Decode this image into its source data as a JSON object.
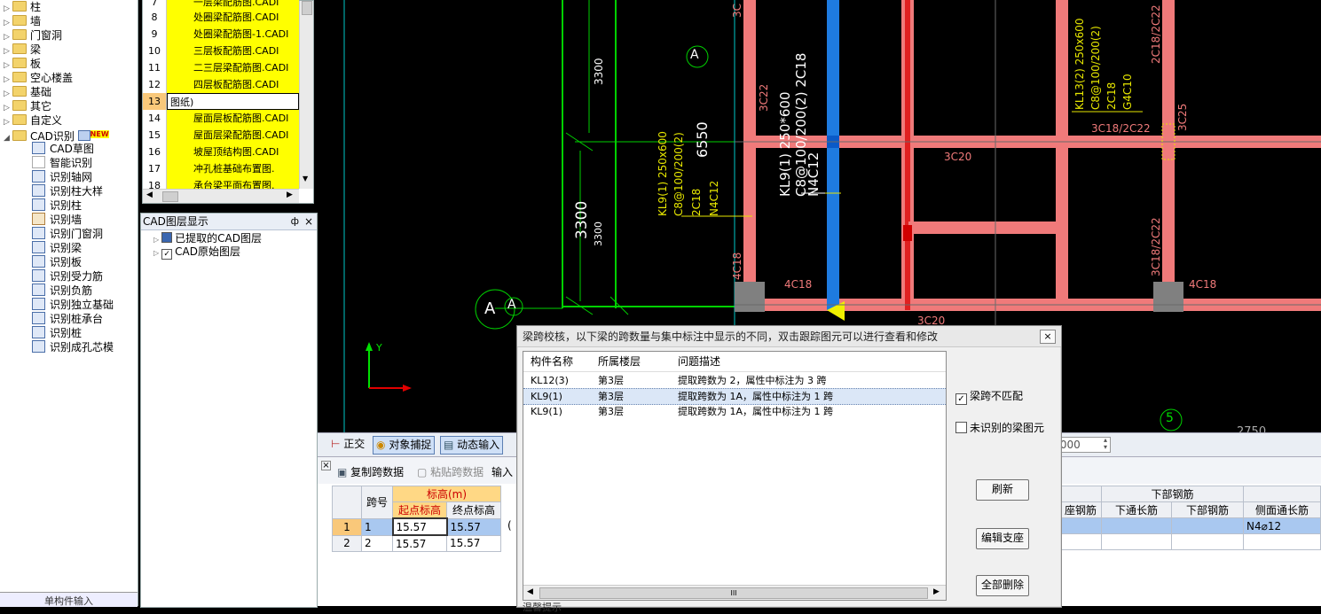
{
  "tree": {
    "nodes": [
      "柱",
      "墙",
      "门窗洞",
      "梁",
      "板",
      "空心楼盖",
      "基础",
      "其它",
      "自定义",
      "CAD识别"
    ],
    "new_badge": "NEW",
    "cad_children": [
      "CAD草图",
      "智能识别",
      "识别轴网",
      "识别柱大样",
      "识别柱",
      "识别墙",
      "识别门窗洞",
      "识别梁",
      "识别板",
      "识别受力筋",
      "识别负筋",
      "识别独立基础",
      "识别桩承台",
      "识别桩",
      "识别成孔芯模"
    ],
    "bottom_label": "单构件输入"
  },
  "drawings": {
    "rows": [
      {
        "num": "7",
        "name": "一层梁配筋图.CADI"
      },
      {
        "num": "8",
        "name": "处圈梁配筋图.CADI"
      },
      {
        "num": "9",
        "name": "处圈梁配筋图-1.CADI"
      },
      {
        "num": "10",
        "name": "三层板配筋图.CADI"
      },
      {
        "num": "11",
        "name": "二三层梁配筋图.CADI"
      },
      {
        "num": "12",
        "name": "四层板配筋图.CADI"
      },
      {
        "num": "13",
        "name": "图纸)"
      },
      {
        "num": "14",
        "name": "屋面层板配筋图.CADI"
      },
      {
        "num": "15",
        "name": "屋面层梁配筋图.CADI"
      },
      {
        "num": "16",
        "name": "坡屋顶结构图.CADI"
      },
      {
        "num": "17",
        "name": "冲孔桩基础布置图."
      },
      {
        "num": "18",
        "name": "承台梁平面布置图."
      }
    ]
  },
  "layers": {
    "title": "CAD图层显示",
    "pin": "ф",
    "close": "×",
    "items": [
      "已提取的CAD图层",
      "CAD原始图层"
    ]
  },
  "cad": {
    "axis_label": "A",
    "axis_5": "5",
    "y_label": "Y",
    "dim_3300": "3300",
    "dim_6550": "6550",
    "kl9_label": "KL9(1) 250*600",
    "kl9_stirrup": "C8@100/200(2) 2C18",
    "kl9_bottom": "N4C12",
    "kl9_left_1": "KL9(1) 250x600",
    "kl9_left_2": "C8@100/200(2)",
    "kl9_left_3": "2C18",
    "kl9_left_4": "N4C12",
    "kl13_1": "KL13(2) 250x600",
    "kl13_2": "C8@100/200(2)",
    "kl13_3": "2C18",
    "kl13_4": "G4C10",
    "r_3c22": "3C22",
    "r_3c20": "3C20",
    "r_4c18": "4C18",
    "r_3c25": "3C25",
    "r_3c18_2c22": "3C18/2C22",
    "r_2c18_2c22": "2C18/2C22",
    "r_3c": "3C",
    "r_2750": "2750"
  },
  "toolbar": {
    "ortho": "正交",
    "snap": "对象捕捉",
    "dyn": "动态输入",
    "zoom": ".000"
  },
  "grid": {
    "copy": "复制跨数据",
    "paste": "粘贴跨数据",
    "input": "输入",
    "col_span": "跨号",
    "col_height": "标高(m)",
    "col_start": "起点标高",
    "col_end": "终点标高",
    "col_bottom_group": "下部钢筋",
    "col_seat": "座钢筋",
    "col_through": "下通长筋",
    "col_bottom": "下部钢筋",
    "col_side": "侧面通长筋",
    "rows": [
      {
        "idx": "1",
        "span": "1",
        "start": "15.57",
        "end": "15.57",
        "extra": "(",
        "side": "N4⌀12"
      },
      {
        "idx": "2",
        "span": "2",
        "start": "15.57",
        "end": "15.57",
        "extra": "",
        "side": ""
      }
    ]
  },
  "dialog": {
    "title": "梁跨校核，以下梁的跨数量与集中标注中显示的不同，双击跟踪图元可以进行查看和修改",
    "close": "×",
    "headers": [
      "构件名称",
      "所属楼层",
      "问题描述"
    ],
    "rows": [
      {
        "name": "KL12(3)",
        "floor": "第3层",
        "desc": "提取跨数为 2，属性中标注为 3 跨"
      },
      {
        "name": "KL9(1)",
        "floor": "第3层",
        "desc": "提取跨数为 1A，属性中标注为 1 跨"
      },
      {
        "name": "KL9(1)",
        "floor": "第3层",
        "desc": "提取跨数为 1A，属性中标注为 1 跨"
      }
    ],
    "check_mismatch": "梁跨不匹配",
    "check_unrecognized": "未识别的梁图元",
    "btn_refresh": "刷新",
    "btn_edit": "编辑支座",
    "btn_delete": "全部删除",
    "footer": "温馨提示",
    "scroll_grip": "III"
  },
  "colors": {
    "beam": "#f07a7a",
    "beam_selected": "#1e7be0",
    "annotation": "#e6e600",
    "grid_line": "#00c800"
  }
}
